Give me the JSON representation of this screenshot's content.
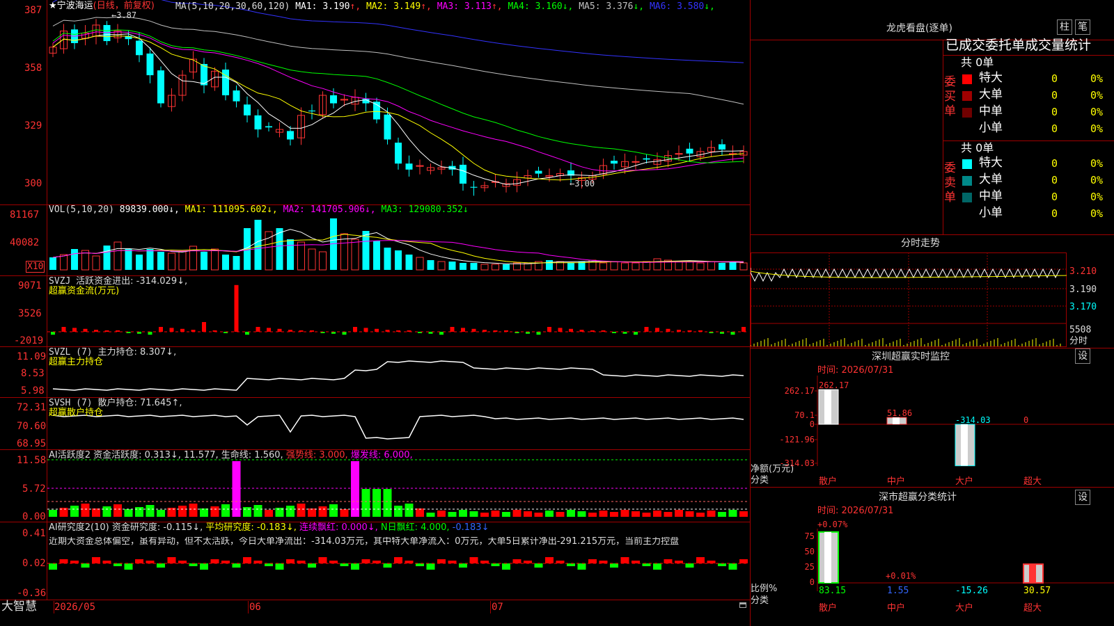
{
  "stock": {
    "title_star": "★",
    "name": "宁波海运",
    "period": "(日线，前复权)",
    "ma_label": "MA(5,10,20,30,60,120)",
    "ma_values": [
      {
        "label": "MA1: 3.190",
        "arrow": "↑",
        "color": "#ffffff"
      },
      {
        "label": "MA2: 3.149",
        "arrow": "↑",
        "color": "#ffff00"
      },
      {
        "label": "MA3: 3.113",
        "arrow": "↑",
        "color": "#ff00ff"
      },
      {
        "label": "MA4: 3.160",
        "arrow": "↓",
        "color": "#00ff00"
      },
      {
        "label": "MA5: 3.376",
        "arrow": "↓",
        "color": "#c0c0c0"
      },
      {
        "label": "MA6: 3.580",
        "arrow": "↓",
        "color": "#3333ff"
      }
    ],
    "high_marker": "3.87",
    "low_marker": "3.00",
    "y_labels": [
      "387",
      "358",
      "329",
      "300"
    ]
  },
  "vol": {
    "label": "VOL(5,10,20)",
    "v1": "89839.000↓,",
    "ma1": "MA1: 111095.602↓,",
    "ma2": "MA2: 141705.906↓,",
    "ma3": "MA3: 129080.352↓",
    "y_labels": [
      "81167",
      "40082"
    ],
    "unit": "X10"
  },
  "svzj": {
    "label": "SVZJ",
    "desc": "活跃资金进出: -314.029↓,",
    "sub": "超赢资金流(万元)",
    "y_labels": [
      "9071",
      "3526",
      "-2019"
    ]
  },
  "svzl": {
    "label": "SVZL (7)",
    "desc": "主力持仓: 8.307↓,",
    "sub": "超赢主力持仓",
    "y_labels": [
      "11.09",
      "8.53",
      "5.98"
    ]
  },
  "svsh": {
    "label": "SVSH (7)",
    "desc": "散户持仓: 71.645↑,",
    "sub": "超赢散户持仓",
    "y_labels": [
      "72.31",
      "70.60",
      "68.95"
    ]
  },
  "ai1": {
    "label": "AI活跃度2",
    "desc": "资金活跃度: 0.313↓, 11.577,",
    "life": "生命线: 1.560,",
    "strong": "强势线: 3.000,",
    "burst": "爆发线: 6.000,",
    "y_labels": [
      "11.58",
      "5.72",
      "0.00"
    ]
  },
  "ai2": {
    "label": "AI研究度2(10)",
    "desc": "资金研究度: -0.115↓,",
    "avg": "平均研究度: -0.183↓,",
    "red": "连续飘红: 0.000↓,",
    "nred": "N日飘红: 4.000,",
    "last": "-0.183↓",
    "summary": "近期大资金总体偏空，虽有异动，但不太活跃，今日大单净流出：-314.03万元，其中特大单净流入：0万元，大单5日累计净出-291.215万元，当前主力控盘",
    "y_labels": [
      "0.41",
      "0.02",
      "-0.36"
    ]
  },
  "bottom": {
    "brand": "大智慧",
    "dates": [
      "2026/05",
      "06",
      "07"
    ]
  },
  "lhkp": {
    "title": "龙虎看盘(逐单)",
    "btn1": "柱",
    "btn2": "笔",
    "header": "已成交委托单成交量统计",
    "buy_label": "委买单",
    "sell_label": "委卖单",
    "buy_total": "共 0单",
    "sell_total": "共 0单",
    "buy_rows": [
      {
        "name": "特大",
        "v": "0",
        "p": "0%",
        "color": "#ff0000"
      },
      {
        "name": "大单",
        "v": "0",
        "p": "0%",
        "color": "#a00000"
      },
      {
        "name": "中单",
        "v": "0",
        "p": "0%",
        "color": "#700000"
      },
      {
        "name": "小单",
        "v": "0",
        "p": "0%",
        "color": ""
      }
    ],
    "sell_rows": [
      {
        "name": "特大",
        "v": "0",
        "p": "0%",
        "color": "#00ffff"
      },
      {
        "name": "大单",
        "v": "0",
        "p": "0%",
        "color": "#008888"
      },
      {
        "name": "中单",
        "v": "0",
        "p": "0%",
        "color": "#006666"
      },
      {
        "name": "小单",
        "v": "0",
        "p": "0%",
        "color": ""
      }
    ]
  },
  "fenshi": {
    "title": "分时走势",
    "y_labels": [
      "3.210",
      "3.190",
      "3.170"
    ],
    "vol_label": "5508",
    "unit": "分时"
  },
  "sz_monitor": {
    "title": "深圳超赢实时监控",
    "btn": "设",
    "date": "时间: 2026/07/31",
    "y_labels": [
      "262.17",
      "70.1",
      "0",
      "-121.96",
      "-314.03"
    ],
    "y_unit_1": "净额(万元)",
    "y_unit_2": "分类",
    "bars": [
      {
        "cat": "散户",
        "value": 262.17,
        "label": "262.17"
      },
      {
        "cat": "中户",
        "value": 51.86,
        "label": "51.86"
      },
      {
        "cat": "大户",
        "value": -314.03,
        "label": "-314.03"
      },
      {
        "cat": "超大",
        "value": 0,
        "label": "0"
      }
    ]
  },
  "sz_class": {
    "title": "深市超赢分类统计",
    "btn": "设",
    "date": "时间: 2026/07/31",
    "y_labels": [
      "75",
      "50",
      "25",
      "0"
    ],
    "y_unit_1": "比例%",
    "y_unit_2": "分类",
    "top_labels": [
      "+0.07%",
      "+0.01%"
    ],
    "bars": [
      {
        "cat": "散户",
        "value": 83.15,
        "label": "83.15"
      },
      {
        "cat": "中户",
        "value": 1.55,
        "label": "1.55"
      },
      {
        "cat": "大户",
        "value": -15.26,
        "label": "-15.26"
      },
      {
        "cat": "超大",
        "value": 30.57,
        "label": "30.57"
      }
    ]
  },
  "chart_data": [
    {
      "type": "candlestick",
      "name": "K线",
      "ohlc_close": [
        3.72,
        3.8,
        3.74,
        3.79,
        3.83,
        3.75,
        3.8,
        3.76,
        3.68,
        3.58,
        3.44,
        3.48,
        3.58,
        3.66,
        3.53,
        3.6,
        3.48,
        3.45,
        3.38,
        3.31,
        3.32,
        3.31,
        3.26,
        3.38,
        3.4,
        3.48,
        3.44,
        3.46,
        3.47,
        3.44,
        3.36,
        3.26,
        3.14,
        3.11,
        3.13,
        3.12,
        3.12,
        3.11,
        3.04,
        3.02,
        3.03,
        3.05,
        3.04,
        3.06,
        3.08,
        3.09,
        3.08,
        3.09,
        3.08,
        3.07,
        3.08,
        3.13,
        3.14,
        3.15,
        3.15,
        3.16,
        3.16,
        3.18,
        3.19,
        3.19,
        3.2,
        3.22,
        3.21,
        3.19,
        3.2
      ],
      "xlabel": "",
      "ylabel": "",
      "ylim": [
        2.95,
        3.92
      ]
    }
  ]
}
